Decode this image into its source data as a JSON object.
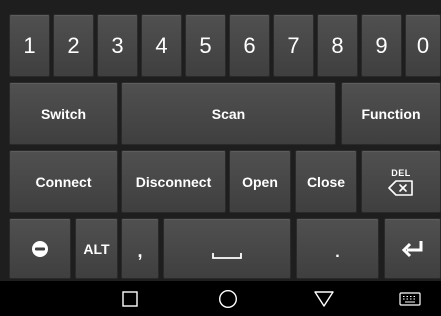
{
  "keyboard": {
    "numbers": [
      "1",
      "2",
      "3",
      "4",
      "5",
      "6",
      "7",
      "8",
      "9",
      "0"
    ],
    "row2": {
      "switch": "Switch",
      "scan": "Scan",
      "function": "Function"
    },
    "row3": {
      "connect": "Connect",
      "disconnect": "Disconnect",
      "open": "Open",
      "close": "Close",
      "del": "DEL"
    },
    "row4": {
      "alt": "ALT",
      "comma": ",",
      "period": "."
    }
  },
  "icons": {
    "backspace": "backspace-icon",
    "emoji": "emoji-icon",
    "space": "space-icon",
    "enter": "enter-icon",
    "nav_recent": "square-icon",
    "nav_home": "circle-icon",
    "nav_back": "triangle-down-icon",
    "nav_keyboard": "keyboard-icon"
  },
  "colors": {
    "key_bg": "#4a4a4a",
    "keyboard_bg": "#1e1e1e",
    "nav_bg": "#000000",
    "text": "#ffffff"
  }
}
